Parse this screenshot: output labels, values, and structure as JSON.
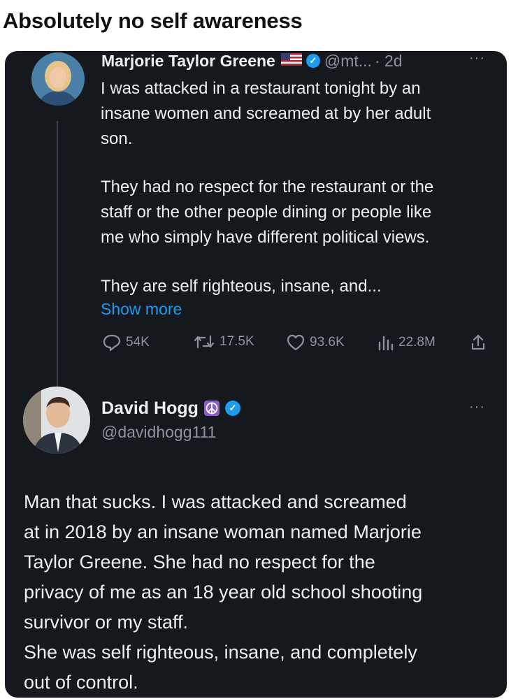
{
  "post": {
    "title": "Absolutely no self awareness"
  },
  "tweet1": {
    "name": "Marjorie Taylor Greene",
    "handle": "@mt...",
    "time": "· 2d",
    "paragraph1": "I was attacked in a restaurant tonight by an\ninsane women and screamed at by her adult\nson.",
    "paragraph2": "They had no respect for the restaurant or the\nstaff or the other people dining or people like\nme who simply have different political views.",
    "paragraph3": "They are self righteous, insane, and...",
    "show_more": "Show more",
    "stats": {
      "replies": "54K",
      "retweets": "17.5K",
      "likes": "93.6K",
      "views": "22.8M"
    }
  },
  "tweet2": {
    "name": "David Hogg",
    "handle": "@davidhogg111",
    "text": "Man that sucks. I was attacked and screamed\nat in 2018 by an insane woman named Marjorie\nTaylor Greene. She had no respect for the\nprivacy of me as an 18 year old school shooting\nsurvivor or my staff.\nShe was self righteous, insane, and completely\nout of control."
  },
  "colors": {
    "card_background": "#15181d",
    "text_primary": "#eceff2",
    "text_secondary": "#8b949e",
    "link": "#1d9bf0",
    "verified_badge": "#1d9bf0"
  },
  "icons": [
    "verified-badge-icon",
    "us-flag-icon",
    "peace-symbol-icon",
    "reply-icon",
    "retweet-icon",
    "like-icon",
    "views-icon",
    "share-icon",
    "more-options-icon"
  ]
}
